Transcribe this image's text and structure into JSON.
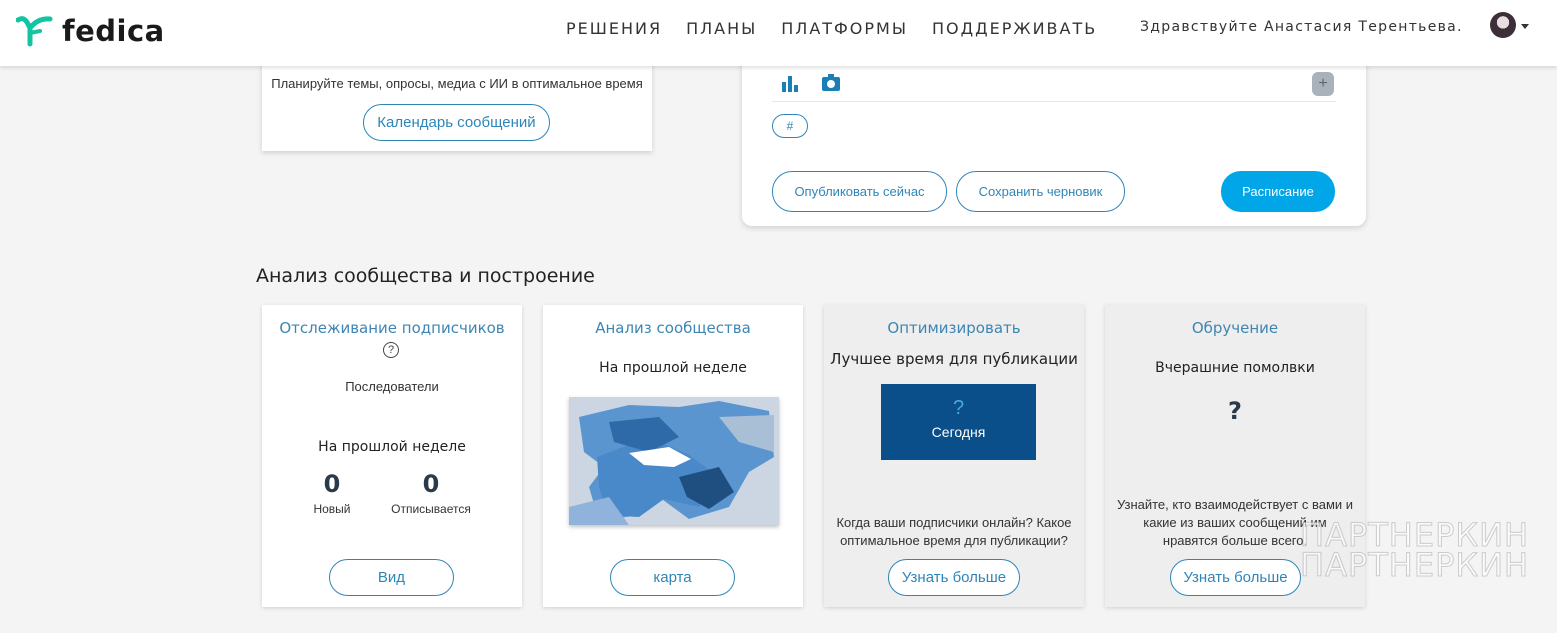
{
  "header": {
    "logo_text": "fedica",
    "nav": [
      "РЕШЕНИЯ",
      "ПЛАНЫ",
      "ПЛАТФОРМЫ",
      "ПОДДЕРЖИВАТЬ"
    ],
    "greeting": "Здравствуйте Анастасия Терентьева.",
    "accent": "#13c3a1"
  },
  "calendar_card": {
    "description": "Планируйте темы, опросы, медиа с ИИ в оптимальное время",
    "button": "Календарь сообщений"
  },
  "composer": {
    "icons": [
      "chart-icon",
      "camera-icon",
      "plus-icon"
    ],
    "plus_label": "+",
    "hashtag_label": "#",
    "publish_now": "Опубликовать сейчас",
    "save_draft": "Сохранить черновик",
    "schedule": "Расписание"
  },
  "section_title": "Анализ сообщества и построение",
  "cards": {
    "followers": {
      "title": "Отслеживание подписчиков",
      "help": "?",
      "subtitle": "Последователи",
      "period": "На прошлой неделе",
      "new_value": "0",
      "new_label": "Новый",
      "unfollow_value": "0",
      "unfollow_label": "Отписывается",
      "button": "Вид"
    },
    "community": {
      "title": "Анализ сообщества",
      "period": "На прошлой неделе",
      "button": "карта"
    },
    "optimize": {
      "title": "Оптимизировать",
      "best_time": "Лучшее время для публикации",
      "question": "?",
      "today": "Сегодня",
      "desc_line1": "Когда ваши подписчики онлайн? Какое",
      "desc_line2": "оптимальное время для публикации?",
      "button": "Узнать больше"
    },
    "engagement": {
      "title": "Обручение",
      "subtitle": "Вчерашние помолвки",
      "question": "?",
      "desc_line1": "Узнайте, кто взаимодействует с вами и",
      "desc_line2": "какие из ваших сообщений им",
      "desc_line3": "нравятся больше всего.",
      "button": "Узнать больше"
    }
  },
  "watermark": {
    "line1": "ПАРТНЕРКИН",
    "line2": "ПАРТНЕРКИН"
  }
}
